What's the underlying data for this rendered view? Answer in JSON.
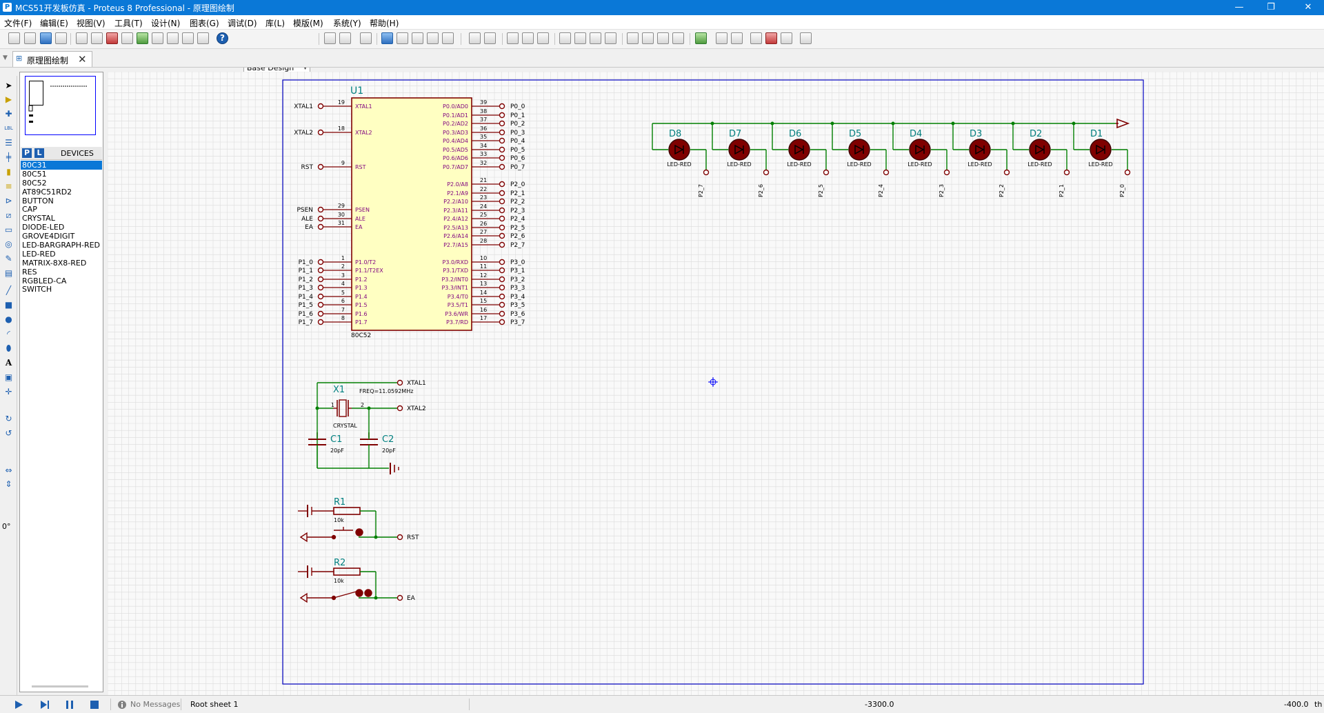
{
  "window": {
    "title": "MCS51开发板仿真 - Proteus 8 Professional - 原理图绘制",
    "minimize": "—",
    "maximize": "❐",
    "close": "✕"
  },
  "menu": [
    {
      "label": "文件(F)"
    },
    {
      "label": "编辑(E)"
    },
    {
      "label": "视图(V)"
    },
    {
      "label": "工具(T)"
    },
    {
      "label": "设计(N)"
    },
    {
      "label": "图表(G)"
    },
    {
      "label": "调试(D)"
    },
    {
      "label": "库(L)"
    },
    {
      "label": "模版(M)"
    },
    {
      "label": "系统(Y)"
    },
    {
      "label": "帮助(H)"
    }
  ],
  "toolbar": {
    "variant": "Base Design",
    "help": "?"
  },
  "tab": {
    "label": "原理图绘制",
    "close": "✕"
  },
  "left_tools": {
    "lbl": "LBL",
    "angle": "0°"
  },
  "devices": {
    "p_button": "P",
    "l_button": "L",
    "header": "DEVICES",
    "items": [
      "80C31",
      "80C51",
      "80C52",
      "AT89C51RD2",
      "BUTTON",
      "CAP",
      "CRYSTAL",
      "DIODE-LED",
      "GROVE4DIGIT",
      "LED-BARGRAPH-RED",
      "LED-RED",
      "MATRIX-8X8-RED",
      "RES",
      "RGBLED-CA",
      "SWITCH"
    ],
    "selected": 0
  },
  "schematic": {
    "mcu": {
      "ref": "U1",
      "part": "80C52",
      "left_pins": [
        {
          "net": "XTAL1",
          "num": "19",
          "name": "XTAL1"
        },
        {
          "net": "XTAL2",
          "num": "18",
          "name": "XTAL2"
        },
        {
          "net": "RST",
          "num": "9",
          "name": "RST"
        },
        {
          "net": "PSEN",
          "num": "29",
          "name": "PSEN"
        },
        {
          "net": "ALE",
          "num": "30",
          "name": "ALE"
        },
        {
          "net": "EA",
          "num": "31",
          "name": "EA"
        },
        {
          "net": "P1_0",
          "num": "1",
          "name": "P1.0/T2"
        },
        {
          "net": "P1_1",
          "num": "2",
          "name": "P1.1/T2EX"
        },
        {
          "net": "P1_2",
          "num": "3",
          "name": "P1.2"
        },
        {
          "net": "P1_3",
          "num": "4",
          "name": "P1.3"
        },
        {
          "net": "P1_4",
          "num": "5",
          "name": "P1.4"
        },
        {
          "net": "P1_5",
          "num": "6",
          "name": "P1.5"
        },
        {
          "net": "P1_6",
          "num": "7",
          "name": "P1.6"
        },
        {
          "net": "P1_7",
          "num": "8",
          "name": "P1.7"
        }
      ],
      "right_pins": [
        {
          "net": "P0_0",
          "num": "39",
          "name": "P0.0/AD0"
        },
        {
          "net": "P0_1",
          "num": "38",
          "name": "P0.1/AD1"
        },
        {
          "net": "P0_2",
          "num": "37",
          "name": "P0.2/AD2"
        },
        {
          "net": "P0_3",
          "num": "36",
          "name": "P0.3/AD3"
        },
        {
          "net": "P0_4",
          "num": "35",
          "name": "P0.4/AD4"
        },
        {
          "net": "P0_5",
          "num": "34",
          "name": "P0.5/AD5"
        },
        {
          "net": "P0_6",
          "num": "33",
          "name": "P0.6/AD6"
        },
        {
          "net": "P0_7",
          "num": "32",
          "name": "P0.7/AD7"
        },
        {
          "net": "P2_0",
          "num": "21",
          "name": "P2.0/A8"
        },
        {
          "net": "P2_1",
          "num": "22",
          "name": "P2.1/A9"
        },
        {
          "net": "P2_2",
          "num": "23",
          "name": "P2.2/A10"
        },
        {
          "net": "P2_3",
          "num": "24",
          "name": "P2.3/A11"
        },
        {
          "net": "P2_4",
          "num": "25",
          "name": "P2.4/A12"
        },
        {
          "net": "P2_5",
          "num": "26",
          "name": "P2.5/A13"
        },
        {
          "net": "P2_6",
          "num": "27",
          "name": "P2.6/A14"
        },
        {
          "net": "P2_7",
          "num": "28",
          "name": "P2.7/A15"
        },
        {
          "net": "P3_0",
          "num": "10",
          "name": "P3.0/RXD"
        },
        {
          "net": "P3_1",
          "num": "11",
          "name": "P3.1/TXD"
        },
        {
          "net": "P3_2",
          "num": "12",
          "name": "P3.2/INT0"
        },
        {
          "net": "P3_3",
          "num": "13",
          "name": "P3.3/INT1"
        },
        {
          "net": "P3_4",
          "num": "14",
          "name": "P3.4/T0"
        },
        {
          "net": "P3_5",
          "num": "15",
          "name": "P3.5/T1"
        },
        {
          "net": "P3_6",
          "num": "16",
          "name": "P3.6/WR"
        },
        {
          "net": "P3_7",
          "num": "17",
          "name": "P3.7/RD"
        }
      ]
    },
    "leds": [
      {
        "ref": "D8",
        "part": "LED-RED",
        "net": "P2_7"
      },
      {
        "ref": "D7",
        "part": "LED-RED",
        "net": "P2_6"
      },
      {
        "ref": "D6",
        "part": "LED-RED",
        "net": "P2_5"
      },
      {
        "ref": "D5",
        "part": "LED-RED",
        "net": "P2_4"
      },
      {
        "ref": "D4",
        "part": "LED-RED",
        "net": "P2_3"
      },
      {
        "ref": "D3",
        "part": "LED-RED",
        "net": "P2_2"
      },
      {
        "ref": "D2",
        "part": "LED-RED",
        "net": "P2_1"
      },
      {
        "ref": "D1",
        "part": "LED-RED",
        "net": "P2_0"
      }
    ],
    "crystal": {
      "ref": "X1",
      "part": "CRYSTAL",
      "freq": "FREQ=11.0592MHz",
      "pin1": "1",
      "pin2": "2",
      "net1": "XTAL1",
      "net2": "XTAL2"
    },
    "c1": {
      "ref": "C1",
      "value": "20pF"
    },
    "c2": {
      "ref": "C2",
      "value": "20pF"
    },
    "r1": {
      "ref": "R1",
      "value": "10k",
      "net": "RST"
    },
    "r2": {
      "ref": "R2",
      "value": "10k",
      "net": "EA"
    }
  },
  "status": {
    "messages": "No Messages",
    "sheet": "Root sheet 1",
    "x": "-3300.0",
    "y": "-400.0",
    "unit": "th"
  },
  "colors": {
    "wire": "#007f00",
    "part": "#7f0000",
    "part_fill": "#ffffc2",
    "ref": "#007f7f",
    "border": "#0000c0",
    "grid": "#dcdcdc"
  }
}
